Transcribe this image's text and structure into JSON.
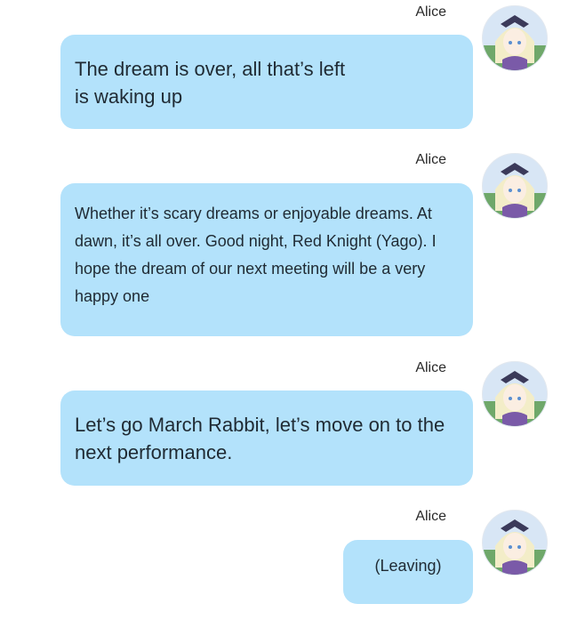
{
  "messages": [
    {
      "sender": "Alice",
      "text": "The dream is over, all that’s left is waking up"
    },
    {
      "sender": "Alice",
      "text": "Whether it’s scary dreams or enjoyable dreams. At dawn, it’s all over. Good night, Red Knight (Yago). I hope the dream of our next meeting will be a very happy one"
    },
    {
      "sender": "Alice",
      "text": "Let’s go March Rabbit, let’s move on to the next performance."
    },
    {
      "sender": "Alice",
      "text": "(Leaving)"
    }
  ],
  "colors": {
    "bubble": "#b3e2fb",
    "background": "#ffffff"
  }
}
